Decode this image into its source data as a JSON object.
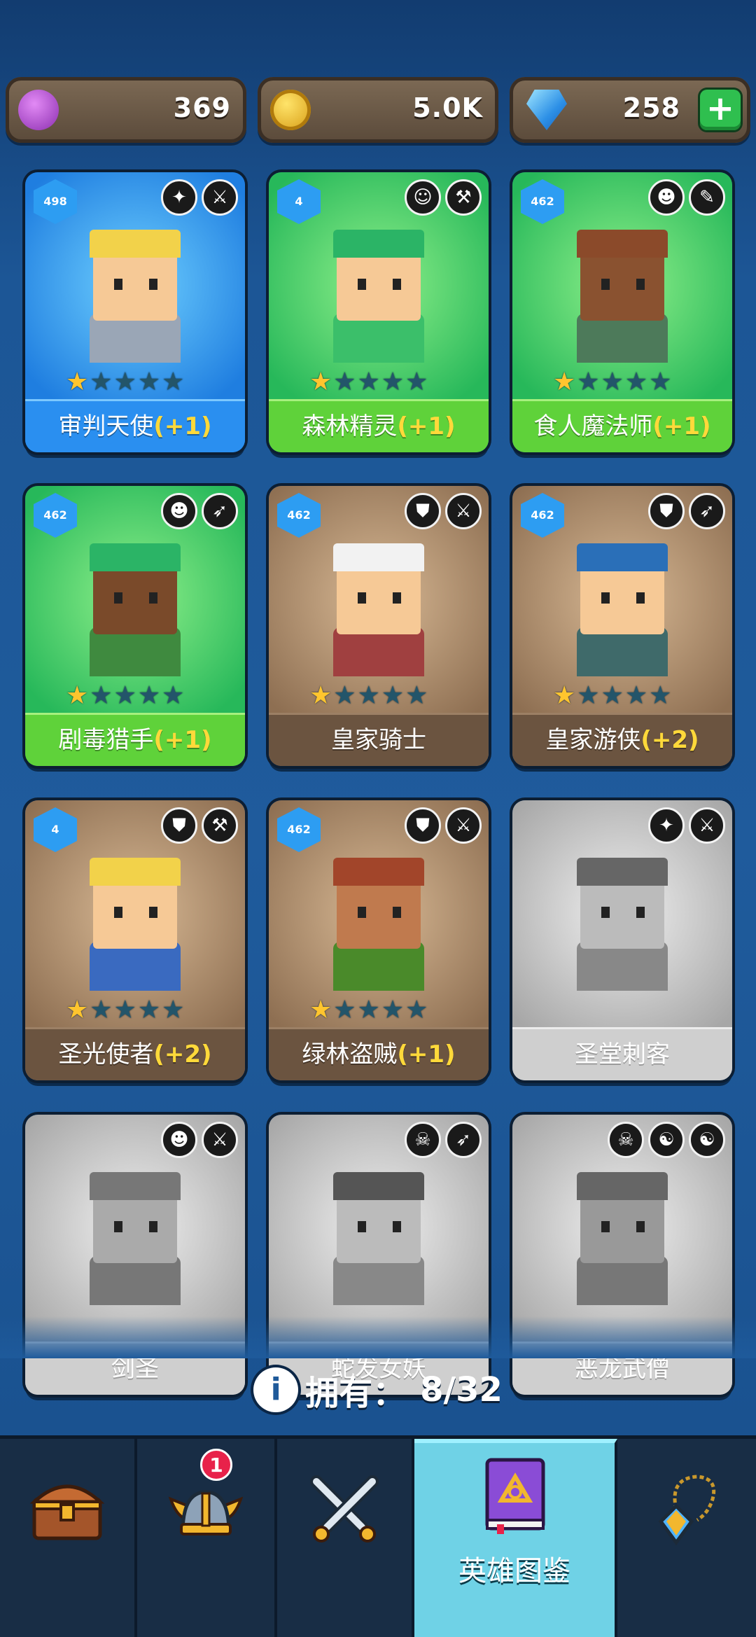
{
  "currency": {
    "elixir": "369",
    "gold": "5.0K",
    "gems": "258",
    "add_label": "+"
  },
  "heroes": [
    {
      "name": "审判天使",
      "bonus": "(+1)",
      "level": "498",
      "stars": 1
    },
    {
      "name": "森林精灵",
      "bonus": "(+1)",
      "level": "4",
      "stars": 1
    },
    {
      "name": "食人魔法师",
      "bonus": "(+1)",
      "level": "462",
      "stars": 1
    },
    {
      "name": "剧毒猎手",
      "bonus": "(+1)",
      "level": "462",
      "stars": 1
    },
    {
      "name": "皇家骑士",
      "bonus": "",
      "level": "462",
      "stars": 1
    },
    {
      "name": "皇家游侠",
      "bonus": "(+2)",
      "level": "462",
      "stars": 1
    },
    {
      "name": "圣光使者",
      "bonus": "(+2)",
      "level": "4",
      "stars": 1
    },
    {
      "name": "绿林盗贼",
      "bonus": "(+1)",
      "level": "462",
      "stars": 1
    },
    {
      "name": "圣堂刺客",
      "bonus": "",
      "level": "",
      "stars": 0
    },
    {
      "name": "剑圣",
      "bonus": "",
      "level": "",
      "stars": 0
    },
    {
      "name": "蛇发女妖",
      "bonus": "",
      "level": "",
      "stars": 0
    },
    {
      "name": "恶龙武僧",
      "bonus": "",
      "level": "",
      "stars": 0
    }
  ],
  "owned": {
    "label": "拥有：",
    "count": "8/32",
    "info_glyph": "i"
  },
  "nav": {
    "notification_count": "1",
    "active_label": "英雄图鉴"
  },
  "icons": {
    "elixir": "purple-elixir-icon",
    "gold": "gold-coin-icon",
    "gems": "blue-gem-icon",
    "tabs": [
      "treasure-chest-icon",
      "viking-helmet-icon",
      "crossed-swords-icon",
      "hero-book-icon",
      "amulet-icon"
    ]
  },
  "colors": {
    "active_tab": "#6fd2e6",
    "bonus": "#ffd93a",
    "star_on": "#ffc52e"
  }
}
